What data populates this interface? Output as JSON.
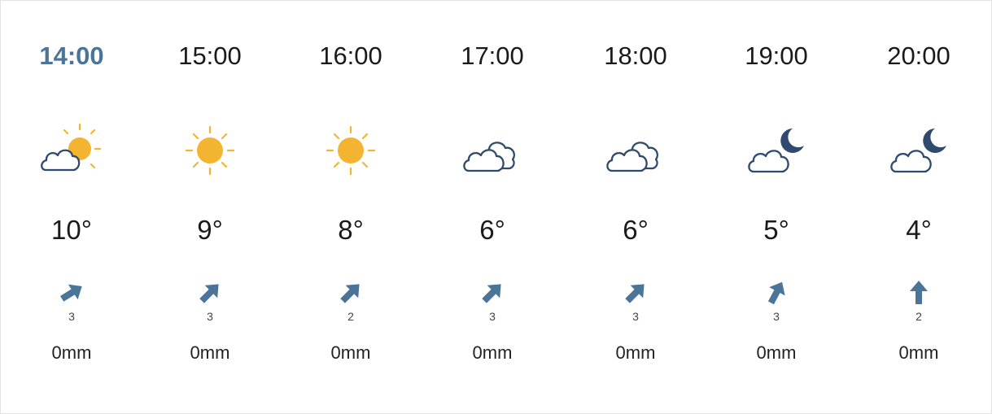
{
  "forecast": [
    {
      "time": "14:00",
      "current": true,
      "condition": "partly-cloudy-day-icon",
      "temp": "10°",
      "wind_speed": "3",
      "wind_direction": "arrow-up-right-icon",
      "precip": "0mm"
    },
    {
      "time": "15:00",
      "current": false,
      "condition": "sun-icon",
      "temp": "9°",
      "wind_speed": "3",
      "wind_direction": "arrow-up-right-icon",
      "precip": "0mm"
    },
    {
      "time": "16:00",
      "current": false,
      "condition": "sun-icon",
      "temp": "8°",
      "wind_speed": "2",
      "wind_direction": "arrow-up-right-icon",
      "precip": "0mm"
    },
    {
      "time": "17:00",
      "current": false,
      "condition": "cloud-icon",
      "temp": "6°",
      "wind_speed": "3",
      "wind_direction": "arrow-up-right-icon",
      "precip": "0mm"
    },
    {
      "time": "18:00",
      "current": false,
      "condition": "cloud-icon",
      "temp": "6°",
      "wind_speed": "3",
      "wind_direction": "arrow-up-right-icon",
      "precip": "0mm"
    },
    {
      "time": "19:00",
      "current": false,
      "condition": "partly-cloudy-night-icon",
      "temp": "5°",
      "wind_speed": "3",
      "wind_direction": "arrow-up-right-icon",
      "precip": "0mm"
    },
    {
      "time": "20:00",
      "current": false,
      "condition": "partly-cloudy-night-icon",
      "temp": "4°",
      "wind_speed": "2",
      "wind_direction": "arrow-up-icon",
      "precip": "0mm"
    }
  ],
  "colors": {
    "accent": "#4b7598",
    "sun": "#f3b531",
    "cloud_outline": "#2f4a6e",
    "moon": "#2f4a6e",
    "wind_arrow": "#4b7598"
  }
}
